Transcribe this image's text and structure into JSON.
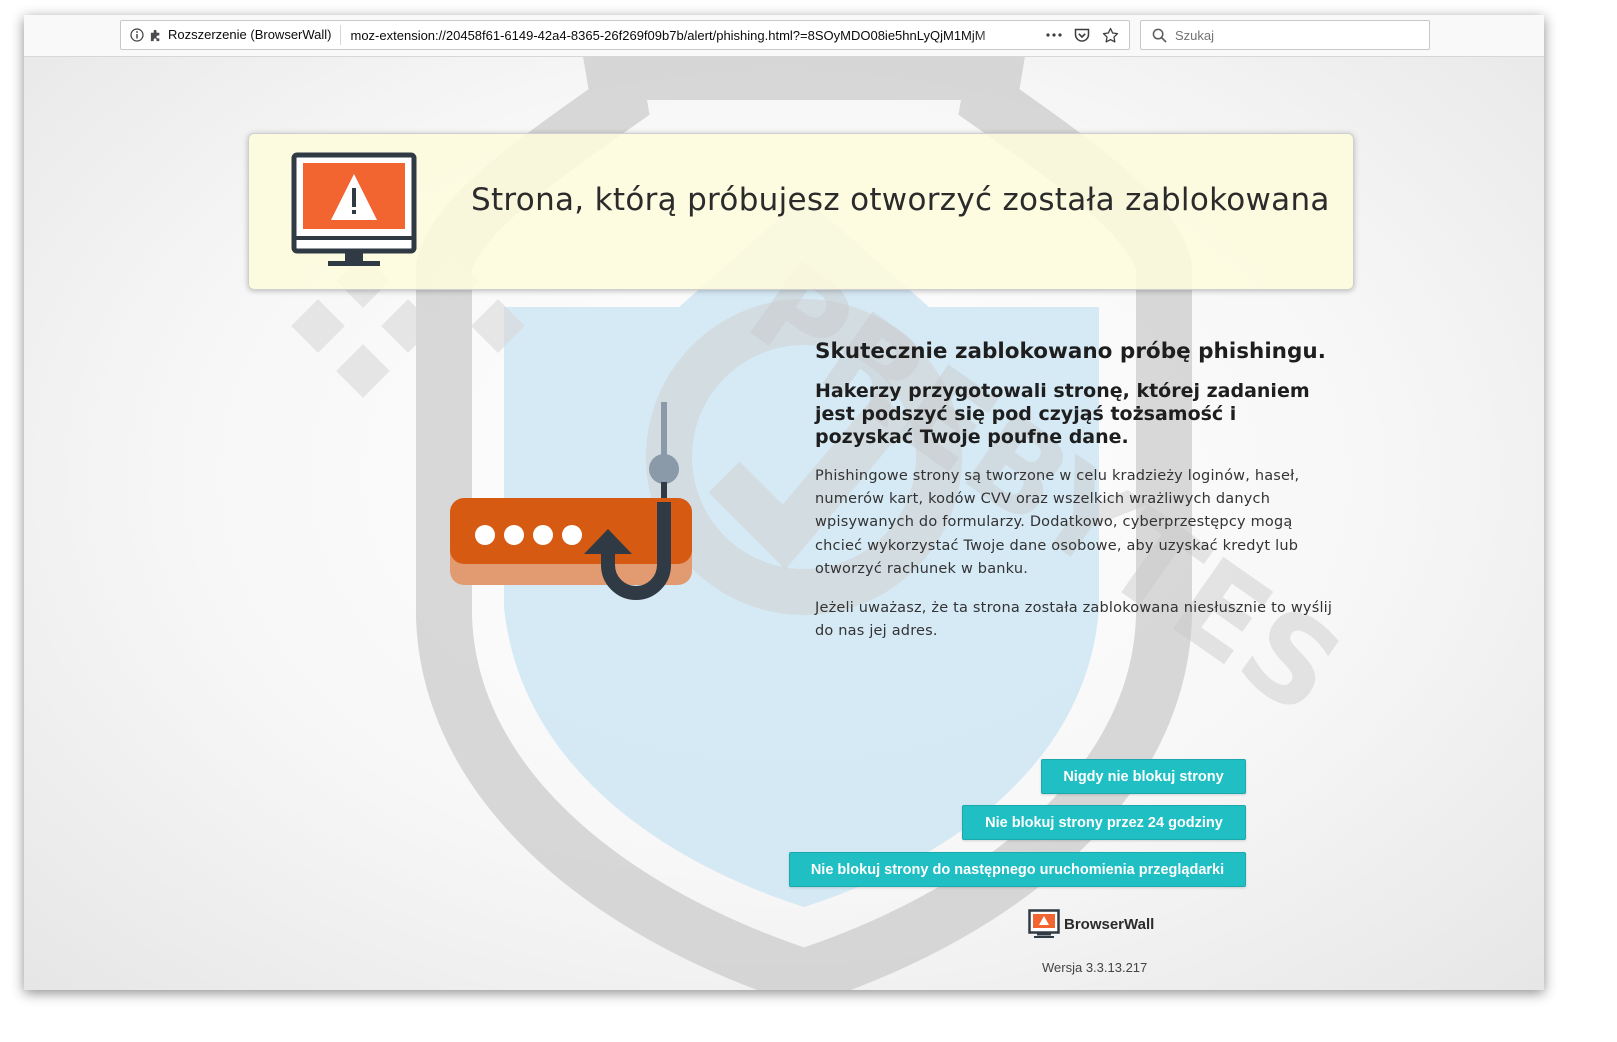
{
  "browser": {
    "identity_label": "Rozszerzenie (BrowserWall)",
    "url": "moz-extension://20458f61-6149-42a4-8365-26f269f09b7b/alert/phishing.html?=8SOyMDO08ie5hnLyQjM1MjM",
    "search_placeholder": "Szukaj",
    "icons": [
      "info-icon",
      "puzzle-icon",
      "more-icon",
      "pocket-icon",
      "bookmark-star-icon",
      "search-icon"
    ]
  },
  "banner": {
    "title": "Strona, którą próbujesz otworzyć została zablokowana",
    "icon": "monitor-warning-icon",
    "colors": {
      "screen": "#f26430",
      "frame": "#2f3a44",
      "background": "#fdfadc"
    }
  },
  "content": {
    "heading": "Skutecznie zablokowano próbę phishingu.",
    "subheading": "Hakerzy przygotowali stronę, której zadaniem jest podszyć się pod czyjąś tożsamość i pozyskać Twoje poufne dane.",
    "paragraph1": "Phishingowe strony są tworzone w celu kradzieży loginów, haseł, numerów kart, kodów CVV oraz wszelkich wrażliwych danych wpisywanych do formularzy. Dodatkowo, cyberprzestępcy mogą chcieć wykorzystać Twoje dane osobowe, aby uzyskać kredyt lub otworzyć rachunek w banku.",
    "paragraph2": "Jeżeli uważasz, że ta strona została zablokowana niesłusznie to wyślij do nas jej adres."
  },
  "illustration": {
    "icon": "password-hook-icon",
    "colors": {
      "bar": "#d65a12",
      "hook": "#2f3a44"
    }
  },
  "buttons": {
    "never_block": "Nigdy nie blokuj strony",
    "unblock_24h": "Nie blokuj strony przez 24 godziny",
    "unblock_until_restart": "Nie blokuj strony do następnego uruchomienia przeglądarki",
    "color": "#1fbfc4"
  },
  "footer": {
    "brand": "BrowserWall",
    "version": "Wersja 3.3.13.217"
  },
  "watermark": {
    "icon": "shield-check-watermark",
    "text": "PREBYTES"
  }
}
